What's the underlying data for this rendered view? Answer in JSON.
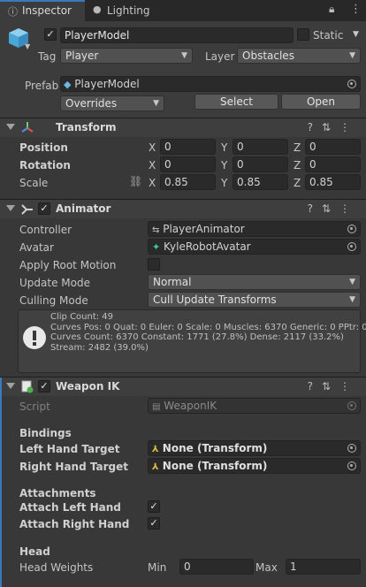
{
  "tabs": {
    "inspector": "Inspector",
    "lighting": "Lighting"
  },
  "object": {
    "name": "PlayerModel",
    "static_label": "Static",
    "tag_label": "Tag",
    "tag_value": "Player",
    "layer_label": "Layer",
    "layer_value": "Obstacles",
    "prefab_label": "Prefab",
    "prefab_value": "PlayerModel",
    "overrides": "Overrides",
    "select": "Select",
    "open": "Open"
  },
  "transform": {
    "title": "Transform",
    "position_label": "Position",
    "rotation_label": "Rotation",
    "scale_label": "Scale",
    "position": [
      "0",
      "0",
      "0"
    ],
    "rotation": [
      "0",
      "0",
      "0"
    ],
    "scale": [
      "0.85",
      "0.85",
      "0.85"
    ],
    "x": "X",
    "y": "Y",
    "z": "Z"
  },
  "animator": {
    "title": "Animator",
    "controller_label": "Controller",
    "controller_value": "PlayerAnimator",
    "avatar_label": "Avatar",
    "avatar_value": "KyleRobotAvatar",
    "apply_root_motion_label": "Apply Root Motion",
    "update_mode_label": "Update Mode",
    "update_mode_value": "Normal",
    "culling_mode_label": "Culling Mode",
    "culling_mode_value": "Cull Update Transforms",
    "info": [
      "Clip Count: 49",
      "Curves Pos: 0 Quat: 0 Euler: 0 Scale: 0 Muscles: 6370 Generic: 0 PPtr: 0",
      "Curves Count: 6370 Constant: 1771 (27.8%) Dense: 2117 (33.2%)",
      "Stream: 2482 (39.0%)"
    ]
  },
  "weapon_ik": {
    "title": "Weapon IK",
    "script_label": "Script",
    "script_value": "WeaponIK",
    "bindings_header": "Bindings",
    "left_hand_label": "Left Hand Target",
    "left_hand_value": "None (Transform)",
    "right_hand_label": "Right Hand Target",
    "right_hand_value": "None (Transform)",
    "attachments_header": "Attachments",
    "attach_left_label": "Attach Left Hand",
    "attach_right_label": "Attach Right Hand",
    "head_header": "Head",
    "head_weights_label": "Head Weights",
    "min_label": "Min",
    "min_value": "0",
    "max_label": "Max",
    "max_value": "1"
  }
}
